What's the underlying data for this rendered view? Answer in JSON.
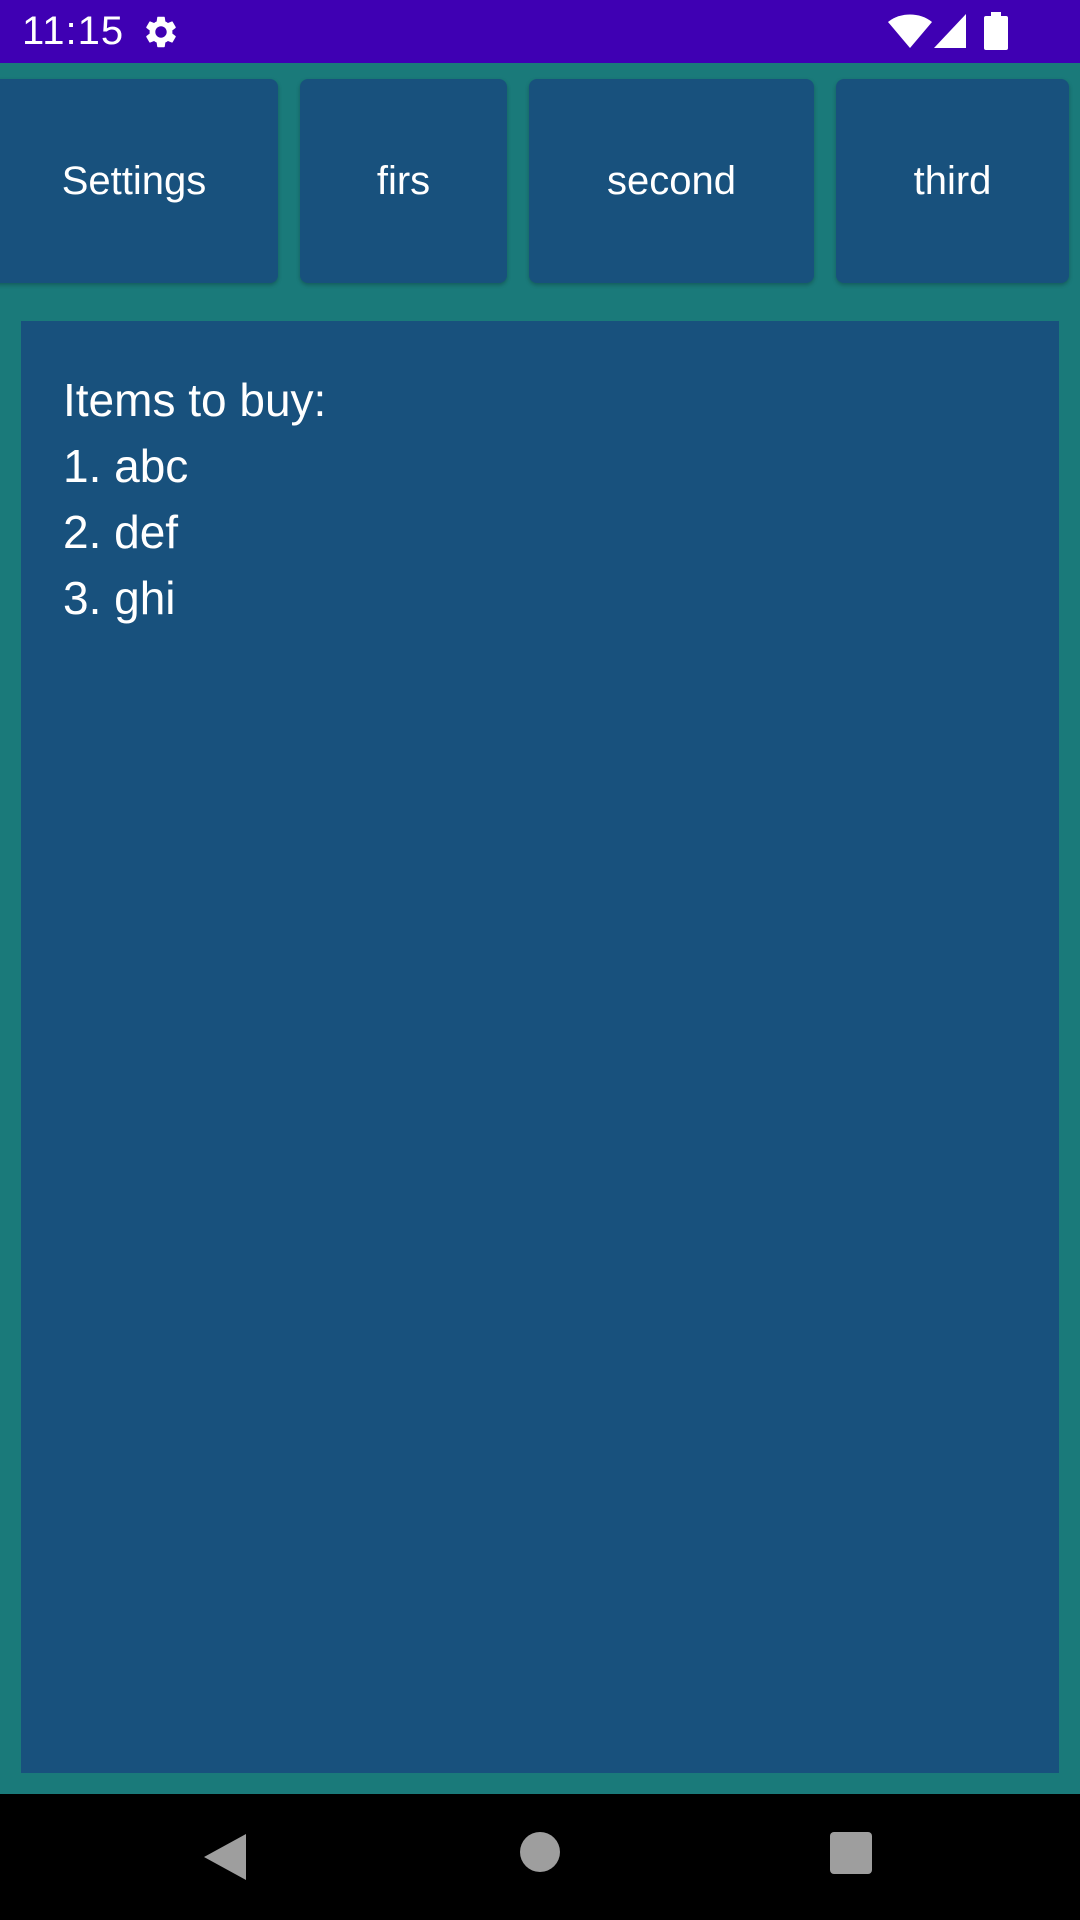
{
  "status_bar": {
    "time": "11:15",
    "icons": [
      "gear-icon",
      "wifi-icon",
      "cell-signal-icon",
      "battery-icon"
    ],
    "background_color": "#3f00b3"
  },
  "toolbar": {
    "buttons": [
      {
        "label": "Settings"
      },
      {
        "label": "firs"
      },
      {
        "label": "second"
      },
      {
        "label": "third"
      }
    ]
  },
  "content": {
    "lines": [
      "Items to buy:",
      "1. abc",
      "2. def",
      "3. ghi"
    ]
  },
  "navigation_bar": {
    "icons": [
      "back-icon",
      "home-icon",
      "recents-icon"
    ]
  },
  "colors": {
    "background": "#1a7a7a",
    "panel": "#18517d",
    "text": "#ffffff"
  }
}
